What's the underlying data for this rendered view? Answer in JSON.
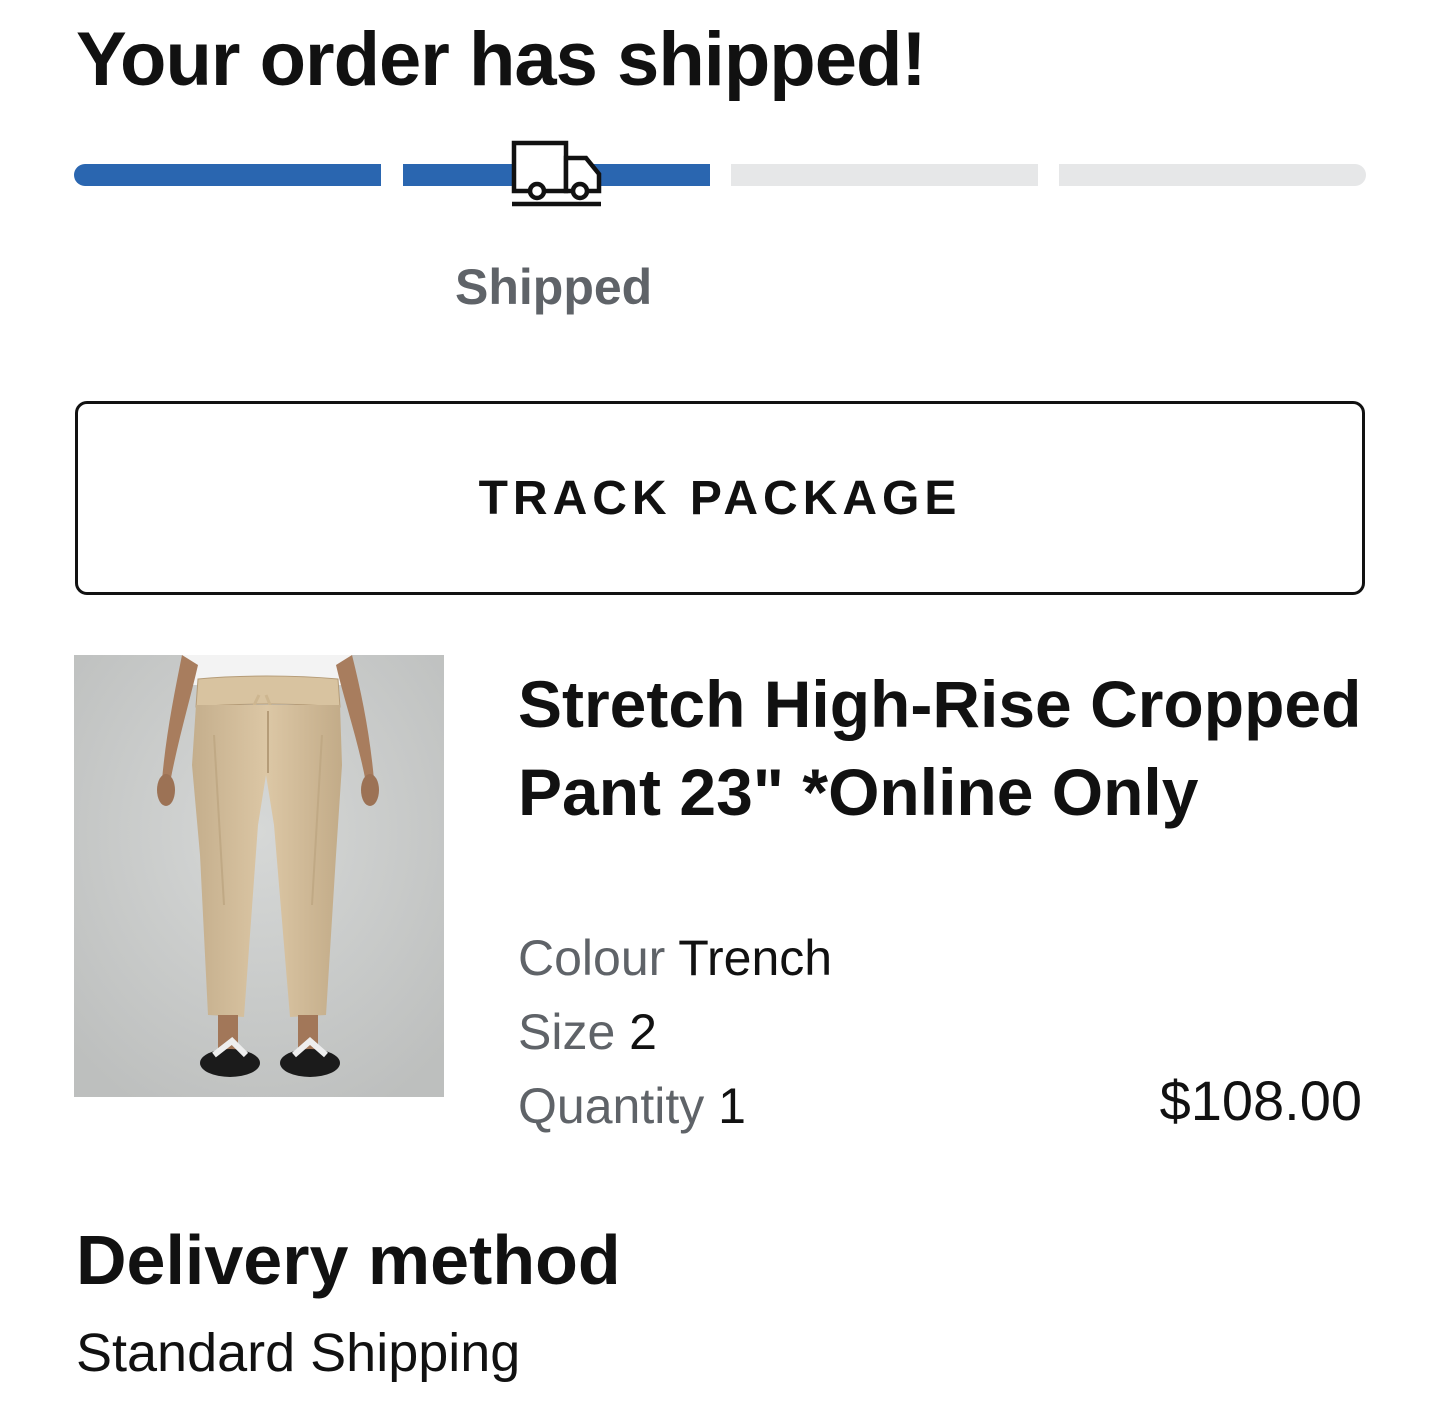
{
  "header": {
    "title": "Your order has shipped!"
  },
  "progress": {
    "steps": [
      {
        "fill": 1.0
      },
      {
        "fill": 1.0
      },
      {
        "fill": 0.0
      },
      {
        "fill": 0.0
      }
    ],
    "current_step_index": 1,
    "current_step_label": "Shipped",
    "current_step_icon": "truck-icon",
    "active_color": "#2a66b0",
    "inactive_color": "#e6e7e8"
  },
  "actions": {
    "track_label": "TRACK PACKAGE"
  },
  "item": {
    "image_icon": "product-photo",
    "name": "Stretch High-Rise Cropped Pant 23\" *Online Only",
    "colour_label": "Colour",
    "colour_value": "Trench",
    "size_label": "Size",
    "size_value": "2",
    "quantity_label": "Quantity",
    "quantity_value": "1",
    "price": "$108.00"
  },
  "delivery": {
    "heading": "Delivery method",
    "method": "Standard Shipping"
  }
}
